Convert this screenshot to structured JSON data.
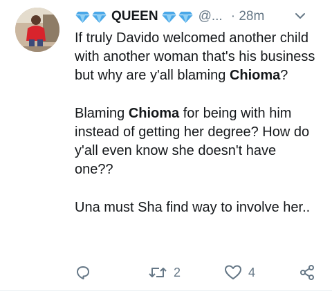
{
  "tweet": {
    "author_name": "QUEEN",
    "handle": "@...",
    "separator": "·",
    "time": "28m",
    "paragraph1": {
      "before": "If truly Davido welcomed another child with another woman that's his business but why are y'all blaming ",
      "bold": "Chioma",
      "after": "?"
    },
    "paragraph2": {
      "before": "Blaming ",
      "bold": "Chioma",
      "after": " for being with him instead of getting her degree? How do y'all even know she doesn't have one??"
    },
    "paragraph3": "Una must Sha find way to involve her..",
    "actions": {
      "reply_icon": "reply-icon",
      "retweet_icon": "retweet-icon",
      "retweet_count": "2",
      "like_icon": "heart-icon",
      "like_count": "4",
      "share_icon": "share-icon"
    }
  },
  "colors": {
    "text": "#14171a",
    "secondary": "#657786",
    "diamond": "#4aa8e8"
  }
}
